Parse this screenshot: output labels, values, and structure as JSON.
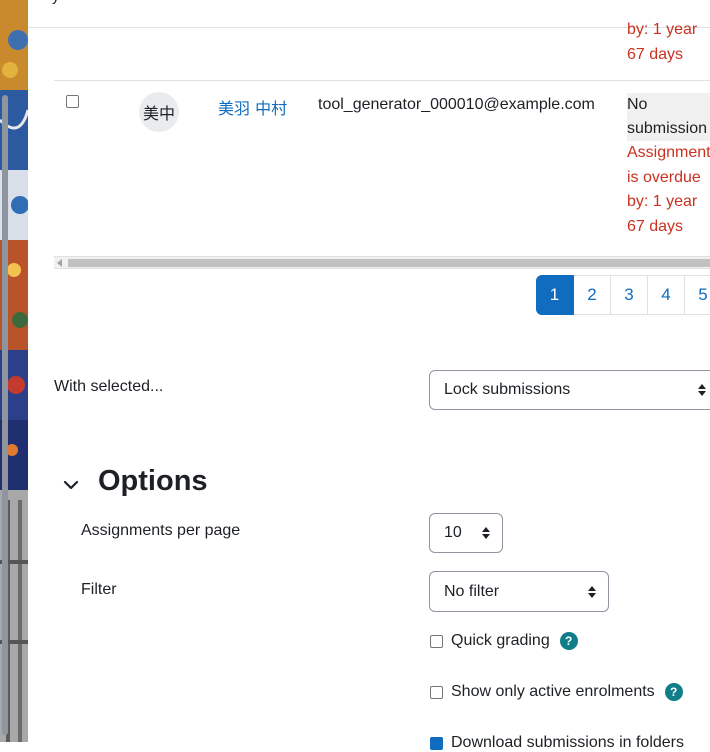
{
  "top_fragment": "y",
  "previous_row": {
    "status_lines": [
      "by: 1 year",
      "67 days"
    ]
  },
  "row": {
    "avatar_initials": "美中",
    "name": "美羽 中村",
    "email": "tool_generator_000010@example.com",
    "status_submission": [
      "No",
      "submission"
    ],
    "status_overdue": [
      "Assignment",
      "is overdue",
      "by: 1 year",
      "67 days"
    ]
  },
  "pagination": {
    "pages": [
      "1",
      "2",
      "3",
      "4",
      "5"
    ],
    "active": "1"
  },
  "with_selected": {
    "label": "With selected...",
    "value": "Lock submissions"
  },
  "options": {
    "heading": "Options",
    "per_page_label": "Assignments per page",
    "per_page_value": "10",
    "filter_label": "Filter",
    "filter_value": "No filter",
    "quick_grading_label": "Quick grading",
    "quick_grading_checked": false,
    "active_enrolments_label": "Show only active enrolments",
    "active_enrolments_checked": false,
    "download_folders_label": "Download submissions in folders",
    "download_folders_checked": true
  },
  "colors": {
    "link": "#0f6cbf",
    "overdue": "#ca3120",
    "help": "#0f7d8a"
  }
}
